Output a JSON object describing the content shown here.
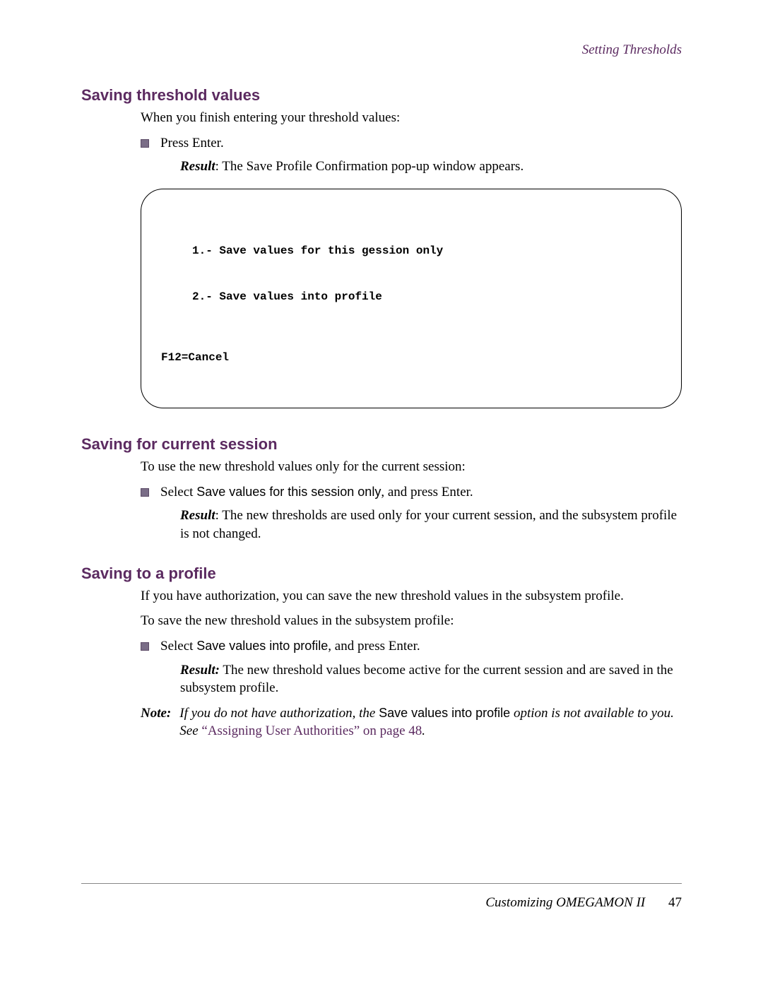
{
  "running_head": "Setting Thresholds",
  "section1": {
    "heading": "Saving threshold values",
    "intro": "When you finish entering your threshold values:",
    "bullet1": "Press Enter.",
    "result_label": "Result",
    "result_text": ": The Save Profile Confirmation pop-up window appears."
  },
  "codebox": {
    "line1": "1.- Save values for this gession only",
    "line2": "2.- Save values into profile",
    "line3": "F12=Cancel"
  },
  "section2": {
    "heading": "Saving for current session",
    "intro": "To use the new threshold values only for the current session:",
    "bullet_pre": "Select ",
    "bullet_ui": "Save values for this session only",
    "bullet_post": ", and press Enter.",
    "result_label": "Result",
    "result_text": ": The new thresholds are used only for your current session, and the subsystem profile is not changed."
  },
  "section3": {
    "heading": "Saving to a profile",
    "p1": "If you have authorization, you can save the new threshold values in the subsystem profile.",
    "p2": "To save the new threshold values in the subsystem profile:",
    "bullet_pre": "Select ",
    "bullet_ui": "Save values into profile",
    "bullet_post": ", and press Enter.",
    "result_label": "Result:",
    "result_text": " The new threshold values become active for the current session and are saved in the subsystem profile.",
    "note_label": "Note:",
    "note_pre": "If you do not have authorization, the ",
    "note_ui": "Save values into profile",
    "note_mid": " option is not available to you. See ",
    "note_xref": "“Assigning User Authorities” on page 48",
    "note_post": "."
  },
  "footer": {
    "title": "Customizing OMEGAMON II",
    "page": "47"
  }
}
